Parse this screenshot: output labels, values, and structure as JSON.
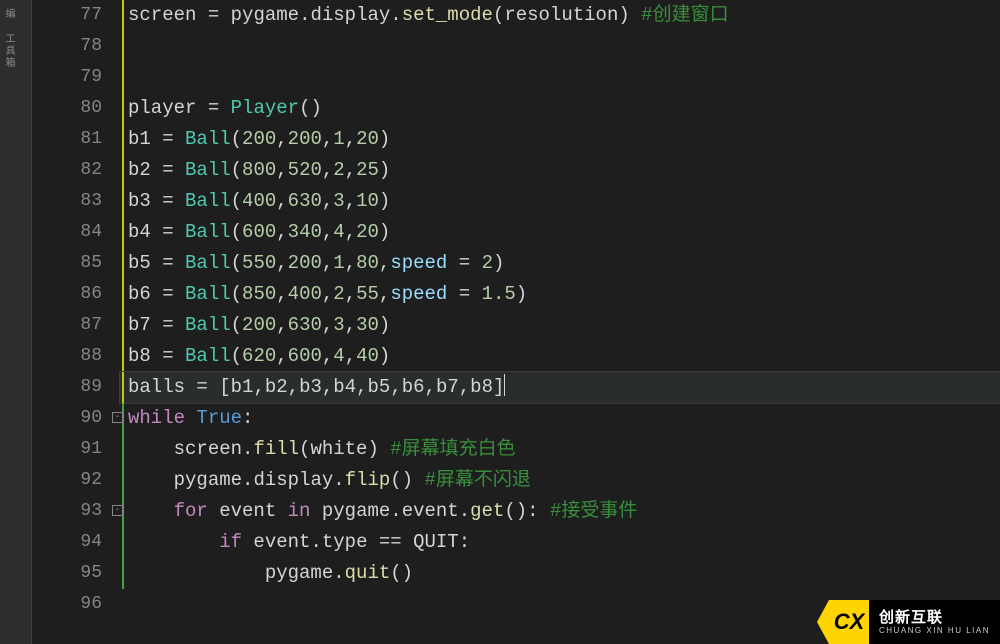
{
  "sidebar": {
    "tabLabel": "编 工具箱"
  },
  "watermark": {
    "logoText": "CX",
    "primary": "创新互联",
    "secondary": "CHUANG XIN HU LIAN"
  },
  "code": {
    "startLine": 77,
    "lines": [
      {
        "n": 77,
        "guide": "yellow",
        "tokens": [
          [
            "ident",
            "screen "
          ],
          [
            "op",
            "= "
          ],
          [
            "ident",
            "pygame"
          ],
          [
            "op",
            "."
          ],
          [
            "ident",
            "display"
          ],
          [
            "op",
            "."
          ],
          [
            "func",
            "set_mode"
          ],
          [
            "op",
            "("
          ],
          [
            "ident",
            "resolution"
          ],
          [
            "op",
            ") "
          ],
          [
            "comment",
            "#创建窗口"
          ]
        ]
      },
      {
        "n": 78,
        "guide": "yellow",
        "tokens": []
      },
      {
        "n": 79,
        "guide": "yellow",
        "tokens": []
      },
      {
        "n": 80,
        "guide": "yellow",
        "tokens": [
          [
            "ident",
            "player "
          ],
          [
            "op",
            "= "
          ],
          [
            "class",
            "Player"
          ],
          [
            "op",
            "()"
          ]
        ]
      },
      {
        "n": 81,
        "guide": "yellow",
        "tokens": [
          [
            "ident",
            "b1 "
          ],
          [
            "op",
            "= "
          ],
          [
            "class",
            "Ball"
          ],
          [
            "op",
            "("
          ],
          [
            "num",
            "200"
          ],
          [
            "op",
            ","
          ],
          [
            "num",
            "200"
          ],
          [
            "op",
            ","
          ],
          [
            "num",
            "1"
          ],
          [
            "op",
            ","
          ],
          [
            "num",
            "20"
          ],
          [
            "op",
            ")"
          ]
        ]
      },
      {
        "n": 82,
        "guide": "yellow",
        "tokens": [
          [
            "ident",
            "b2 "
          ],
          [
            "op",
            "= "
          ],
          [
            "class",
            "Ball"
          ],
          [
            "op",
            "("
          ],
          [
            "num",
            "800"
          ],
          [
            "op",
            ","
          ],
          [
            "num",
            "520"
          ],
          [
            "op",
            ","
          ],
          [
            "num",
            "2"
          ],
          [
            "op",
            ","
          ],
          [
            "num",
            "25"
          ],
          [
            "op",
            ")"
          ]
        ]
      },
      {
        "n": 83,
        "guide": "yellow",
        "tokens": [
          [
            "ident",
            "b3 "
          ],
          [
            "op",
            "= "
          ],
          [
            "class",
            "Ball"
          ],
          [
            "op",
            "("
          ],
          [
            "num",
            "400"
          ],
          [
            "op",
            ","
          ],
          [
            "num",
            "630"
          ],
          [
            "op",
            ","
          ],
          [
            "num",
            "3"
          ],
          [
            "op",
            ","
          ],
          [
            "num",
            "10"
          ],
          [
            "op",
            ")"
          ]
        ]
      },
      {
        "n": 84,
        "guide": "yellow",
        "tokens": [
          [
            "ident",
            "b4 "
          ],
          [
            "op",
            "= "
          ],
          [
            "class",
            "Ball"
          ],
          [
            "op",
            "("
          ],
          [
            "num",
            "600"
          ],
          [
            "op",
            ","
          ],
          [
            "num",
            "340"
          ],
          [
            "op",
            ","
          ],
          [
            "num",
            "4"
          ],
          [
            "op",
            ","
          ],
          [
            "num",
            "20"
          ],
          [
            "op",
            ")"
          ]
        ]
      },
      {
        "n": 85,
        "guide": "yellow",
        "tokens": [
          [
            "ident",
            "b5 "
          ],
          [
            "op",
            "= "
          ],
          [
            "class",
            "Ball"
          ],
          [
            "op",
            "("
          ],
          [
            "num",
            "550"
          ],
          [
            "op",
            ","
          ],
          [
            "num",
            "200"
          ],
          [
            "op",
            ","
          ],
          [
            "num",
            "1"
          ],
          [
            "op",
            ","
          ],
          [
            "num",
            "80"
          ],
          [
            "op",
            ","
          ],
          [
            "param",
            "speed "
          ],
          [
            "op",
            "= "
          ],
          [
            "num",
            "2"
          ],
          [
            "op",
            ")"
          ]
        ]
      },
      {
        "n": 86,
        "guide": "yellow",
        "tokens": [
          [
            "ident",
            "b6 "
          ],
          [
            "op",
            "= "
          ],
          [
            "class",
            "Ball"
          ],
          [
            "op",
            "("
          ],
          [
            "num",
            "850"
          ],
          [
            "op",
            ","
          ],
          [
            "num",
            "400"
          ],
          [
            "op",
            ","
          ],
          [
            "num",
            "2"
          ],
          [
            "op",
            ","
          ],
          [
            "num",
            "55"
          ],
          [
            "op",
            ","
          ],
          [
            "param",
            "speed "
          ],
          [
            "op",
            "= "
          ],
          [
            "num",
            "1.5"
          ],
          [
            "op",
            ")"
          ]
        ]
      },
      {
        "n": 87,
        "guide": "yellow",
        "tokens": [
          [
            "ident",
            "b7 "
          ],
          [
            "op",
            "= "
          ],
          [
            "class",
            "Ball"
          ],
          [
            "op",
            "("
          ],
          [
            "num",
            "200"
          ],
          [
            "op",
            ","
          ],
          [
            "num",
            "630"
          ],
          [
            "op",
            ","
          ],
          [
            "num",
            "3"
          ],
          [
            "op",
            ","
          ],
          [
            "num",
            "30"
          ],
          [
            "op",
            ")"
          ]
        ]
      },
      {
        "n": 88,
        "guide": "yellow",
        "tokens": [
          [
            "ident",
            "b8 "
          ],
          [
            "op",
            "= "
          ],
          [
            "class",
            "Ball"
          ],
          [
            "op",
            "("
          ],
          [
            "num",
            "620"
          ],
          [
            "op",
            ","
          ],
          [
            "num",
            "600"
          ],
          [
            "op",
            ","
          ],
          [
            "num",
            "4"
          ],
          [
            "op",
            ","
          ],
          [
            "num",
            "40"
          ],
          [
            "op",
            ")"
          ]
        ]
      },
      {
        "n": 89,
        "guide": "yellow",
        "current": true,
        "cursorAtEnd": true,
        "tokens": [
          [
            "ident",
            "balls "
          ],
          [
            "op",
            "= ["
          ],
          [
            "ident",
            "b1"
          ],
          [
            "op",
            ","
          ],
          [
            "ident",
            "b2"
          ],
          [
            "op",
            ","
          ],
          [
            "ident",
            "b3"
          ],
          [
            "op",
            ","
          ],
          [
            "ident",
            "b4"
          ],
          [
            "op",
            ","
          ],
          [
            "ident",
            "b5"
          ],
          [
            "op",
            ","
          ],
          [
            "ident",
            "b6"
          ],
          [
            "op",
            ","
          ],
          [
            "ident",
            "b7"
          ],
          [
            "op",
            ","
          ],
          [
            "ident",
            "b8"
          ],
          [
            "op",
            "]"
          ]
        ]
      },
      {
        "n": 90,
        "guide": "green",
        "fold": true,
        "tokens": [
          [
            "kw",
            "while"
          ],
          [
            "ident",
            " "
          ],
          [
            "const",
            "True"
          ],
          [
            "op",
            ":"
          ]
        ]
      },
      {
        "n": 91,
        "guide": "green",
        "tokens": [
          [
            "ident",
            "    screen"
          ],
          [
            "op",
            "."
          ],
          [
            "func",
            "fill"
          ],
          [
            "op",
            "("
          ],
          [
            "ident",
            "white"
          ],
          [
            "op",
            ") "
          ],
          [
            "comment",
            "#屏幕填充白色"
          ]
        ]
      },
      {
        "n": 92,
        "guide": "green",
        "tokens": [
          [
            "ident",
            "    pygame"
          ],
          [
            "op",
            "."
          ],
          [
            "ident",
            "display"
          ],
          [
            "op",
            "."
          ],
          [
            "func",
            "flip"
          ],
          [
            "op",
            "() "
          ],
          [
            "comment",
            "#屏幕不闪退"
          ]
        ]
      },
      {
        "n": 93,
        "guide": "green",
        "fold": true,
        "tokens": [
          [
            "ident",
            "    "
          ],
          [
            "kw",
            "for"
          ],
          [
            "ident",
            " event "
          ],
          [
            "kw",
            "in"
          ],
          [
            "ident",
            " pygame"
          ],
          [
            "op",
            "."
          ],
          [
            "ident",
            "event"
          ],
          [
            "op",
            "."
          ],
          [
            "func",
            "get"
          ],
          [
            "op",
            "(): "
          ],
          [
            "comment",
            "#接受事件"
          ]
        ]
      },
      {
        "n": 94,
        "guide": "green",
        "tokens": [
          [
            "ident",
            "        "
          ],
          [
            "kw",
            "if"
          ],
          [
            "ident",
            " event"
          ],
          [
            "op",
            "."
          ],
          [
            "ident",
            "type "
          ],
          [
            "op",
            "== "
          ],
          [
            "ident",
            "QUIT"
          ],
          [
            "op",
            ":"
          ]
        ]
      },
      {
        "n": 95,
        "guide": "green",
        "tokens": [
          [
            "ident",
            "            pygame"
          ],
          [
            "op",
            "."
          ],
          [
            "func",
            "quit"
          ],
          [
            "op",
            "()"
          ]
        ]
      },
      {
        "n": 96,
        "guide": "none",
        "tokens": []
      }
    ]
  }
}
